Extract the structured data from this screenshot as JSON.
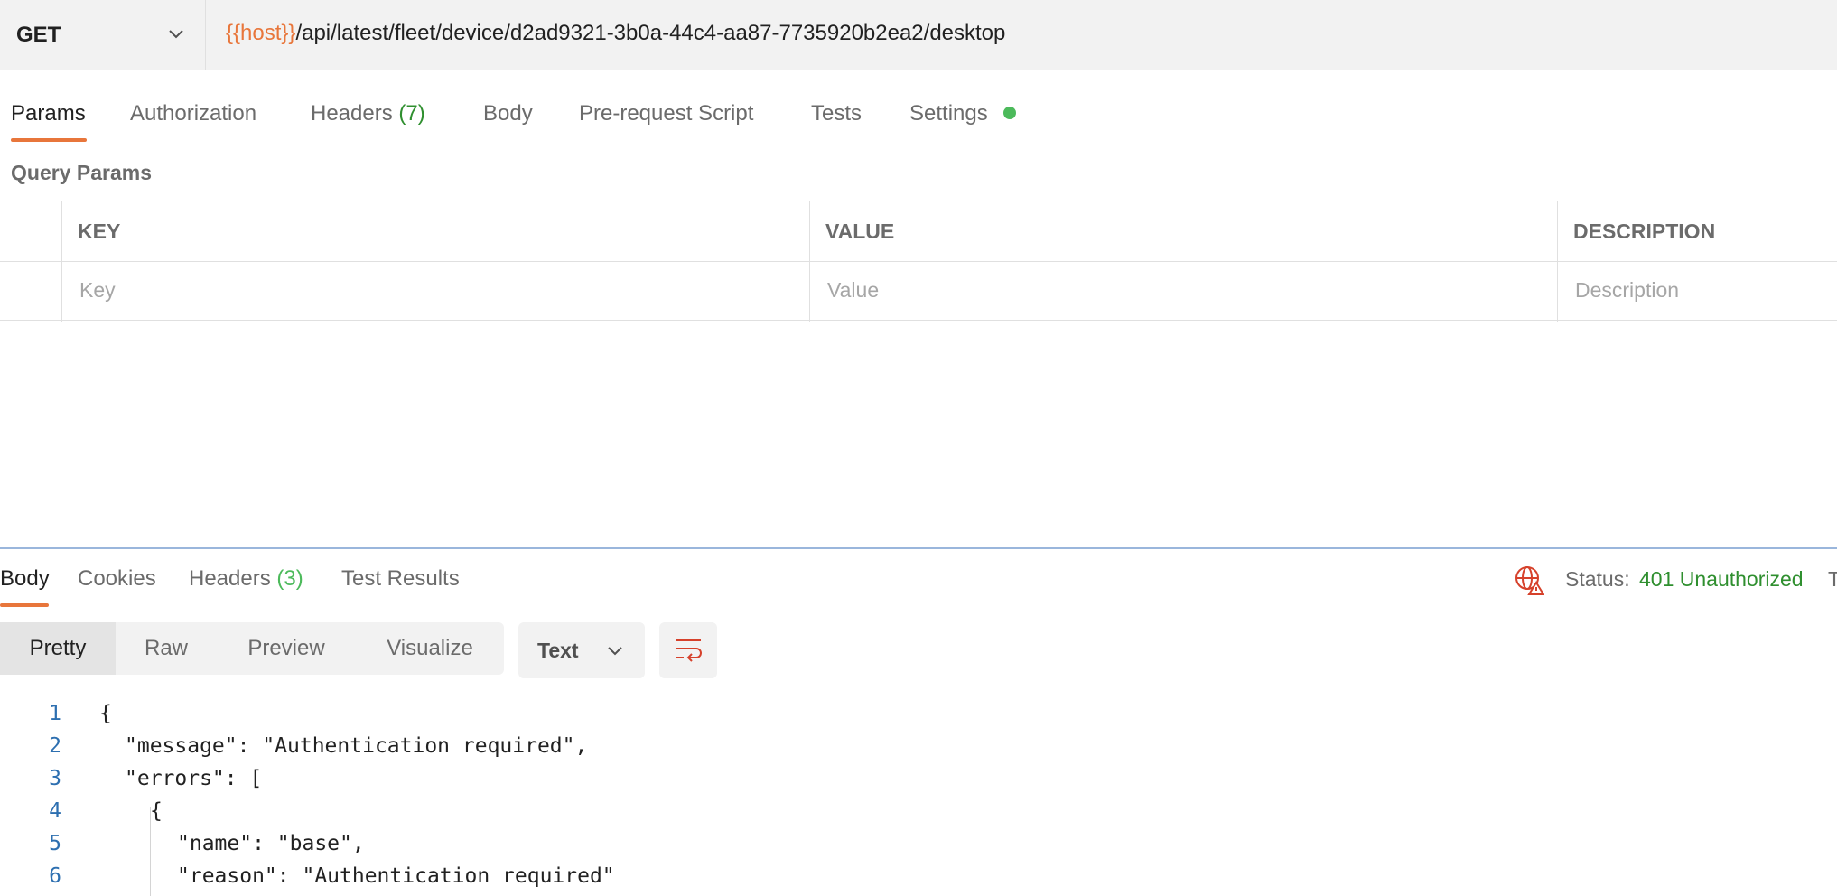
{
  "request": {
    "method": "GET",
    "url_variable": "{{host}}",
    "url_path": "/api/latest/fleet/device/d2ad9321-3b0a-44c4-aa87-7735920b2ea2/desktop"
  },
  "request_tabs": {
    "params": "Params",
    "authorization": "Authorization",
    "headers": "Headers",
    "headers_count": "(7)",
    "body": "Body",
    "pre_request_script": "Pre-request Script",
    "tests": "Tests",
    "settings": "Settings"
  },
  "query_params": {
    "title": "Query Params",
    "columns": [
      "KEY",
      "VALUE",
      "DESCRIPTION"
    ],
    "placeholders": [
      "Key",
      "Value",
      "Description"
    ]
  },
  "response_tabs": {
    "body": "Body",
    "cookies": "Cookies",
    "headers": "Headers",
    "headers_count": "(3)",
    "test_results": "Test Results"
  },
  "status": {
    "label": "Status:",
    "value": "401 Unauthorized",
    "more": "T"
  },
  "view_modes": {
    "pretty": "Pretty",
    "raw": "Raw",
    "preview": "Preview",
    "visualize": "Visualize",
    "selected": "Pretty"
  },
  "format": {
    "selected": "Text"
  },
  "code_lines": [
    {
      "n": "1",
      "text": "{"
    },
    {
      "n": "2",
      "text": "\"message\": \"Authentication required\","
    },
    {
      "n": "3",
      "text": "\"errors\": ["
    },
    {
      "n": "4",
      "text": "{"
    },
    {
      "n": "5",
      "text": "\"name\": \"base\","
    },
    {
      "n": "6",
      "text": "\"reason\": \"Authentication required\""
    }
  ],
  "colors": {
    "accent": "#e8763b",
    "success": "#2f8f2f",
    "settings_dot": "#4cba5b",
    "error_icon": "#d6412b",
    "line_number": "#2d6fb0"
  },
  "icons": {
    "method_dropdown": "chevron-down-icon",
    "status": "globe-error-icon",
    "format_dropdown": "chevron-down-icon",
    "wrap": "wrap-lines-icon"
  }
}
